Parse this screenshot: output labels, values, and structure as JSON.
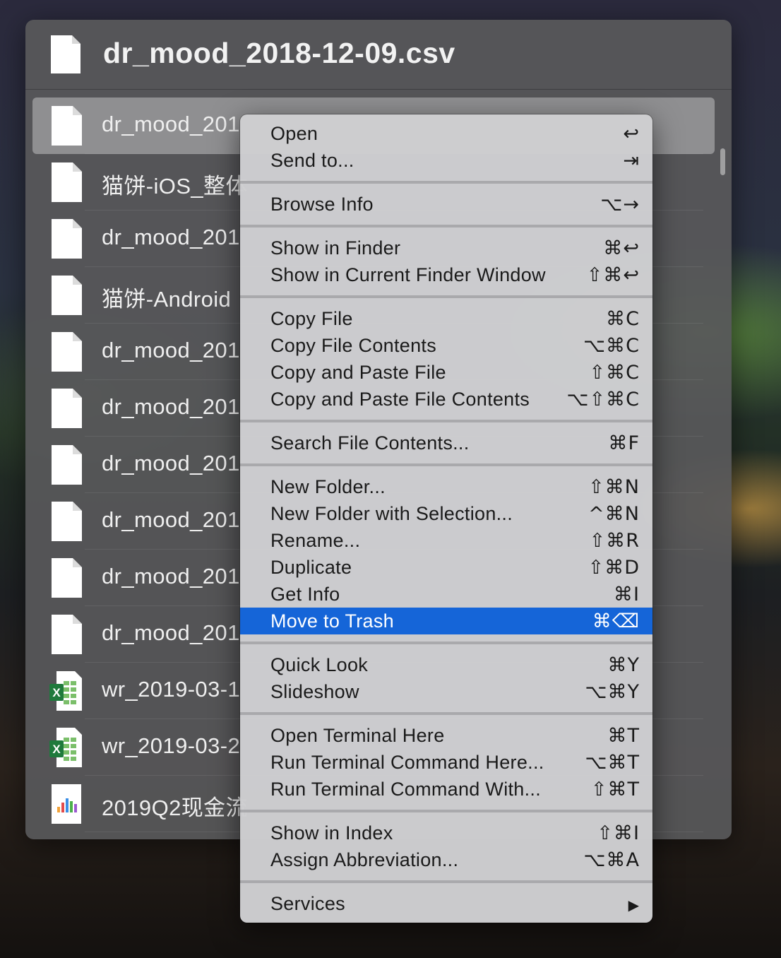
{
  "header": {
    "title": "dr_mood_2018-12-09.csv",
    "icon": "document-icon"
  },
  "files": [
    {
      "name": "dr_mood_201",
      "icon": "document-icon",
      "selected": true
    },
    {
      "name": "猫饼-iOS_整体",
      "icon": "document-icon",
      "selected": false
    },
    {
      "name": "dr_mood_201",
      "icon": "document-icon",
      "selected": false
    },
    {
      "name": "猫饼-Android",
      "icon": "document-icon",
      "selected": false
    },
    {
      "name": "dr_mood_201",
      "icon": "document-icon",
      "selected": false
    },
    {
      "name": "dr_mood_201",
      "icon": "document-icon",
      "selected": false
    },
    {
      "name": "dr_mood_201",
      "icon": "document-icon",
      "selected": false
    },
    {
      "name": "dr_mood_201",
      "icon": "document-icon",
      "selected": false
    },
    {
      "name": "dr_mood_201",
      "icon": "document-icon",
      "selected": false
    },
    {
      "name": "dr_mood_201",
      "icon": "document-icon",
      "selected": false
    },
    {
      "name": "wr_2019-03-1",
      "icon": "excel-icon",
      "selected": false
    },
    {
      "name": "wr_2019-03-2",
      "icon": "excel-icon",
      "selected": false
    },
    {
      "name": "2019Q2现金流",
      "icon": "numbers-chart-icon",
      "selected": false
    }
  ],
  "menu": {
    "groups": [
      [
        {
          "label": "Open",
          "shortcut": "↩"
        },
        {
          "label": "Send to...",
          "shortcut": "⇥"
        }
      ],
      [
        {
          "label": "Browse Info",
          "shortcut": "⌥→"
        }
      ],
      [
        {
          "label": "Show in Finder",
          "shortcut": "⌘↩"
        },
        {
          "label": "Show in Current Finder Window",
          "shortcut": "⇧⌘↩"
        }
      ],
      [
        {
          "label": "Copy File",
          "shortcut": "⌘C"
        },
        {
          "label": "Copy File Contents",
          "shortcut": "⌥⌘C"
        },
        {
          "label": "Copy and Paste File",
          "shortcut": "⇧⌘C"
        },
        {
          "label": "Copy and Paste File Contents",
          "shortcut": "⌥⇧⌘C"
        }
      ],
      [
        {
          "label": "Search File Contents...",
          "shortcut": "⌘F"
        }
      ],
      [
        {
          "label": "New Folder...",
          "shortcut": "⇧⌘N"
        },
        {
          "label": "New Folder with Selection...",
          "shortcut": "^⌘N"
        },
        {
          "label": "Rename...",
          "shortcut": "⇧⌘R"
        },
        {
          "label": "Duplicate",
          "shortcut": "⇧⌘D"
        },
        {
          "label": "Get Info",
          "shortcut": "⌘I"
        },
        {
          "label": "Move to Trash",
          "shortcut": "⌘⌫",
          "highlighted": true
        }
      ],
      [
        {
          "label": "Quick Look",
          "shortcut": "⌘Y"
        },
        {
          "label": "Slideshow",
          "shortcut": "⌥⌘Y"
        }
      ],
      [
        {
          "label": "Open Terminal Here",
          "shortcut": "⌘T"
        },
        {
          "label": "Run Terminal Command Here...",
          "shortcut": "⌥⌘T"
        },
        {
          "label": "Run Terminal Command With...",
          "shortcut": "⇧⌘T"
        }
      ],
      [
        {
          "label": "Show in Index",
          "shortcut": "⇧⌘I"
        },
        {
          "label": "Assign Abbreviation...",
          "shortcut": "⌥⌘A"
        }
      ],
      [
        {
          "label": "Services",
          "shortcut": "▶"
        }
      ]
    ]
  }
}
